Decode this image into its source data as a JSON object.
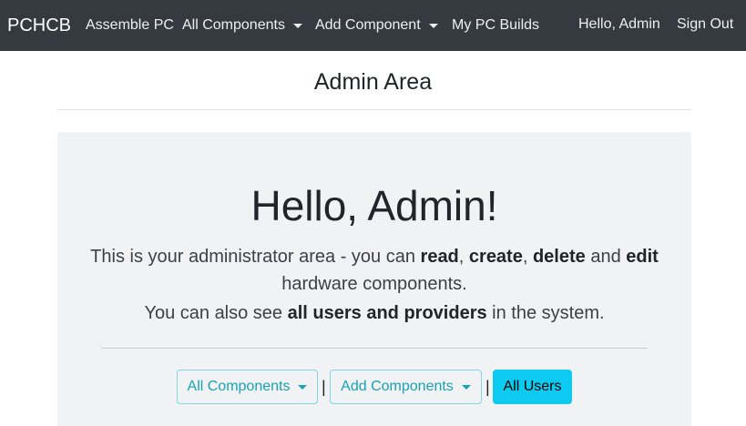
{
  "navbar": {
    "brand": "PCHCB",
    "items": [
      {
        "label": "Assemble PC"
      },
      {
        "label": "All Components"
      },
      {
        "label": "Add Component"
      },
      {
        "label": "My PC Builds"
      }
    ],
    "greeting": "Hello, Admin",
    "sign_out": "Sign Out",
    "bg_color": "#343a40"
  },
  "page": {
    "title": "Admin Area"
  },
  "jumbotron": {
    "heading": "Hello, Admin!",
    "line1_prefix": "This is your administrator area - you can ",
    "read": "read",
    "comma1": ",",
    "create": "create",
    "comma2": ",",
    "delete": "delete",
    "and": " and ",
    "edit": "edit",
    "line2": "hardware components.",
    "line3_prefix": "You can also see ",
    "line3_bold": "all users and providers",
    "line3_suffix": " in the system."
  },
  "actions": {
    "all_components": "All Components",
    "add_components": "Add Components",
    "all_users": "All Users",
    "separator": "|",
    "accent_color": "#17a2b8"
  }
}
